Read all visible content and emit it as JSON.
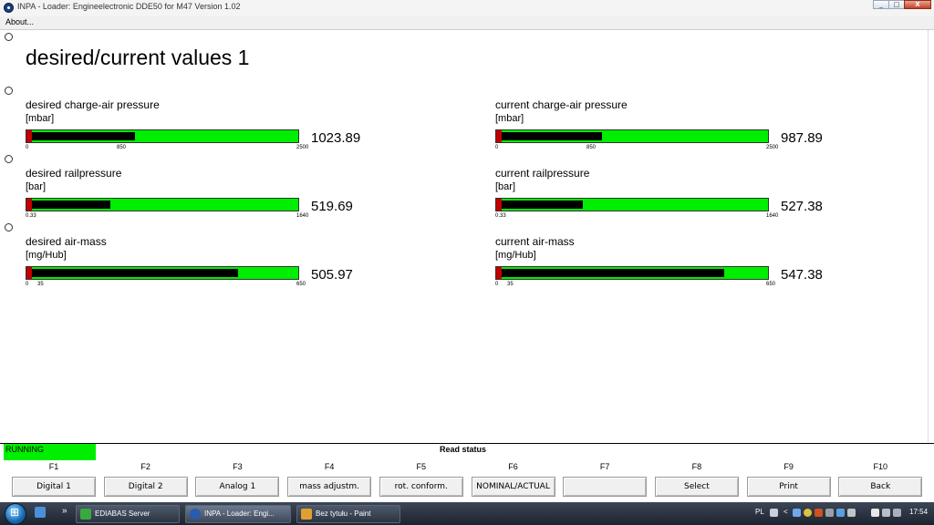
{
  "window": {
    "title": "INPA - Loader:  Engineelectronic DDE50 for M47 Version 1.02",
    "min_label": "_",
    "max_label": "□",
    "close_label": "X"
  },
  "menu": {
    "about_label": "About..."
  },
  "page": {
    "title": "desired/current values 1"
  },
  "gauges": [
    {
      "label": "desired charge-air pressure",
      "unit": "[mbar]",
      "value": "1023.89",
      "fill_fraction": 0.4,
      "ticks": [
        "0",
        "850",
        "2500"
      ]
    },
    {
      "label": "current charge-air pressure",
      "unit": "[mbar]",
      "value": "987.89",
      "fill_fraction": 0.39,
      "ticks": [
        "0",
        "850",
        "2500"
      ]
    },
    {
      "label": "desired railpressure",
      "unit": "[bar]",
      "value": "519.69",
      "fill_fraction": 0.31,
      "ticks": [
        "0.33",
        "1640"
      ]
    },
    {
      "label": "current railpressure",
      "unit": "[bar]",
      "value": "527.38",
      "fill_fraction": 0.32,
      "ticks": [
        "0.33",
        "1640"
      ]
    },
    {
      "label": "desired air-mass",
      "unit": "[mg/Hub]",
      "value": "505.97",
      "fill_fraction": 0.78,
      "ticks": [
        "0",
        "35",
        "650"
      ]
    },
    {
      "label": "current air-mass",
      "unit": "[mg/Hub]",
      "value": "547.38",
      "fill_fraction": 0.84,
      "ticks": [
        "0",
        "35",
        "650"
      ]
    }
  ],
  "status": {
    "running": "RUNNING",
    "read_status": "Read status"
  },
  "fkeys": [
    {
      "key": "F1",
      "label": "Digital 1"
    },
    {
      "key": "F2",
      "label": "Digital 2"
    },
    {
      "key": "F3",
      "label": "Analog 1"
    },
    {
      "key": "F4",
      "label": "mass adjustm."
    },
    {
      "key": "F5",
      "label": "rot. conform."
    },
    {
      "key": "F6",
      "label": "NOMINAL/ACTUAL"
    },
    {
      "key": "F7",
      "label": ""
    },
    {
      "key": "F8",
      "label": "Select"
    },
    {
      "key": "F9",
      "label": "Print"
    },
    {
      "key": "F10",
      "label": "Back"
    }
  ],
  "taskbar": {
    "overflow_label": "»",
    "tasks": [
      {
        "label": "EDIABAS Server",
        "icon": "ediabas-icon"
      },
      {
        "label": "INPA - Loader: Engi...",
        "icon": "inpa-icon"
      },
      {
        "label": "Bez tytułu - Paint",
        "icon": "paint-icon"
      }
    ],
    "language": "PL",
    "clock": "17:54"
  },
  "colors": {
    "gauge_green": "#00ee00",
    "gauge_black": "#000000",
    "gauge_red": "#c00000",
    "running_green": "#00ee00"
  }
}
